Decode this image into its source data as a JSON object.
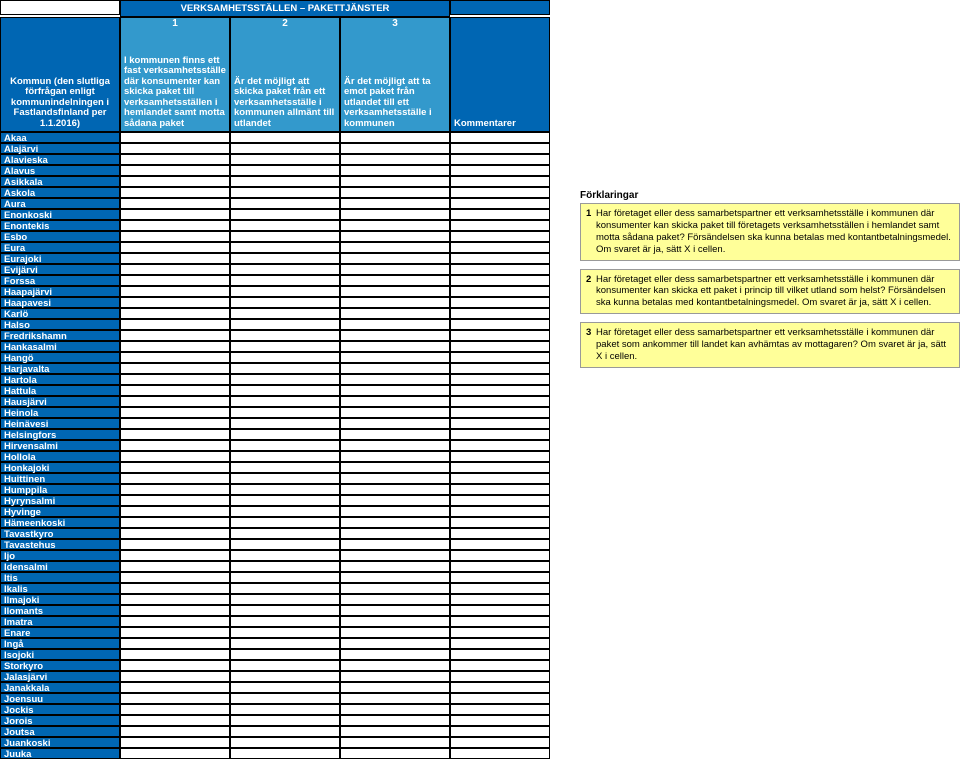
{
  "table": {
    "group_header": "VERKSAMHETSSTÄLLEN – PAKETTJÄNSTER",
    "nums": [
      "1",
      "2",
      "3"
    ],
    "col0": "Kommun (den slutliga förfrågan enligt kommunindelningen i Fastlandsfinland per 1.1.2016)",
    "col1": "I kommunen finns ett fast verksamhetsställe där konsumenter kan skicka paket till verksamhetsställen i hemlandet samt motta sådana paket",
    "col2": "Är det möjligt att skicka paket från ett verksamhetsställe i kommunen allmänt till utlandet",
    "col3": "Är det möjligt att ta emot paket från utlandet till ett verksamhetsställe i kommunen",
    "col4": "Kommentarer",
    "rows": [
      "Akaa",
      "Alajärvi",
      "Alavieska",
      "Alavus",
      "Asikkala",
      "Askola",
      "Aura",
      "Enonkoski",
      "Enontekis",
      "Esbo",
      "Eura",
      "Eurajoki",
      "Evijärvi",
      "Forssa",
      "Haapajärvi",
      "Haapavesi",
      "Karlö",
      "Halso",
      "Fredrikshamn",
      "Hankasalmi",
      "Hangö",
      "Harjavalta",
      "Hartola",
      "Hattula",
      "Hausjärvi",
      "Heinola",
      "Heinävesi",
      "Helsingfors",
      "Hirvensalmi",
      "Hollola",
      "Honkajoki",
      "Huittinen",
      "Humppila",
      "Hyrynsalmi",
      "Hyvinge",
      "Hämeenkoski",
      "Tavastkyro",
      "Tavastehus",
      "Ijo",
      "Idensalmi",
      "Itis",
      "Ikalis",
      "Ilmajoki",
      "Ilomants",
      "Imatra",
      "Enare",
      "Ingå",
      "Isojoki",
      "Storkyro",
      "Jalasjärvi",
      "Janakkala",
      "Joensuu",
      "Jockis",
      "Jorois",
      "Joutsa",
      "Juankoski",
      "Juuka"
    ]
  },
  "explanations": {
    "title": "Förklaringar",
    "items": [
      {
        "num": "1",
        "text": "Har företaget eller dess samarbetspartner ett verksamhetsställe i kommunen där konsumenter kan skicka paket till företagets verksamhetsställen i hemlandet samt motta sådana paket? Försändelsen ska kunna betalas med kontantbetalningsmedel. Om svaret är ja, sätt X i cellen."
      },
      {
        "num": "2",
        "text": "Har företaget eller dess samarbetspartner ett verksamhetsställe i kommunen där konsumenter kan skicka ett paket i princip till vilket utland som helst? Försändelsen ska kunna betalas med kontantbetalningsmedel. Om svaret är ja, sätt X i cellen."
      },
      {
        "num": "3",
        "text": "Har företaget eller dess samarbetspartner ett verksamhetsställe i kommunen där paket som ankommer till landet kan avhämtas av mottagaren? Om svaret är ja, sätt X i cellen."
      }
    ]
  }
}
